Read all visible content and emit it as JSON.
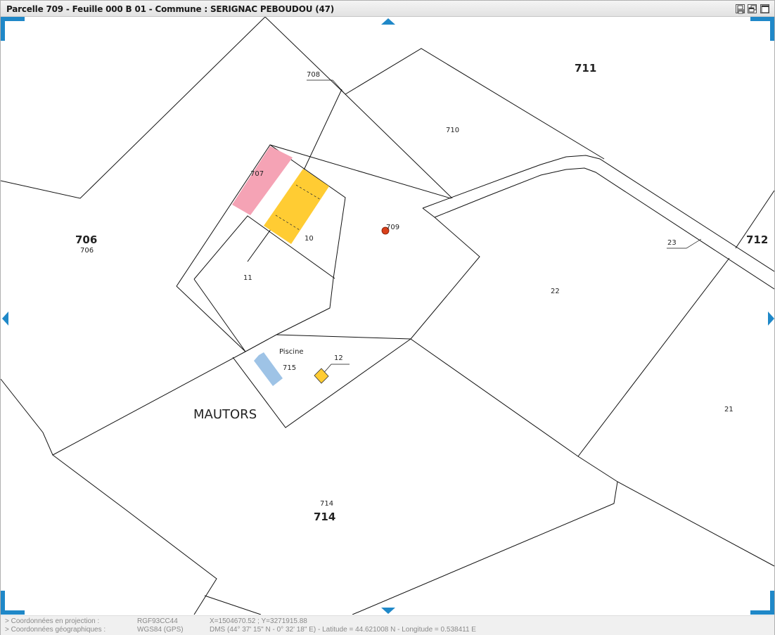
{
  "window": {
    "title": "Parcelle 709 - Feuille 000 B 01 - Commune : SERIGNAC PEBOUDOU (47)"
  },
  "toolbar": {
    "icons": [
      "print-icon",
      "restore-icon",
      "maximize-icon"
    ]
  },
  "map": {
    "parcel_labels_large": [
      "711",
      "706",
      "712",
      "714"
    ],
    "parcel_labels_small": {
      "p708": "708",
      "p710": "710",
      "p707": "707",
      "p706": "706",
      "p709": "709",
      "p10": "10",
      "p11": "11",
      "p23": "23",
      "p22": "22",
      "piscine": "Piscine",
      "p715": "715",
      "p12": "12",
      "p21": "21",
      "p714": "714"
    },
    "large": {
      "p711": "711",
      "p706": "706",
      "p712": "712",
      "p714": "714"
    },
    "place_name": "MAUTORS",
    "colors": {
      "selected_parcel": "#f5a3b5",
      "building": "#ffcc33",
      "pool": "#9ec3e6",
      "marker": "#d9401a",
      "nav_accent": "#1f88c8"
    }
  },
  "status": {
    "projection_label": "> Coordonnées en projection :",
    "projection_system": "RGF93CC44",
    "projection_value": "X=1504670.52 ; Y=3271915.88",
    "geo_label": "> Coordonnées géographiques :",
    "geo_system": "WGS84 (GPS)",
    "geo_value": "DMS (44° 37' 15\" N - 0° 32' 18\" E) - Latitude = 44.621008 N - Longitude = 0.538411 E"
  }
}
